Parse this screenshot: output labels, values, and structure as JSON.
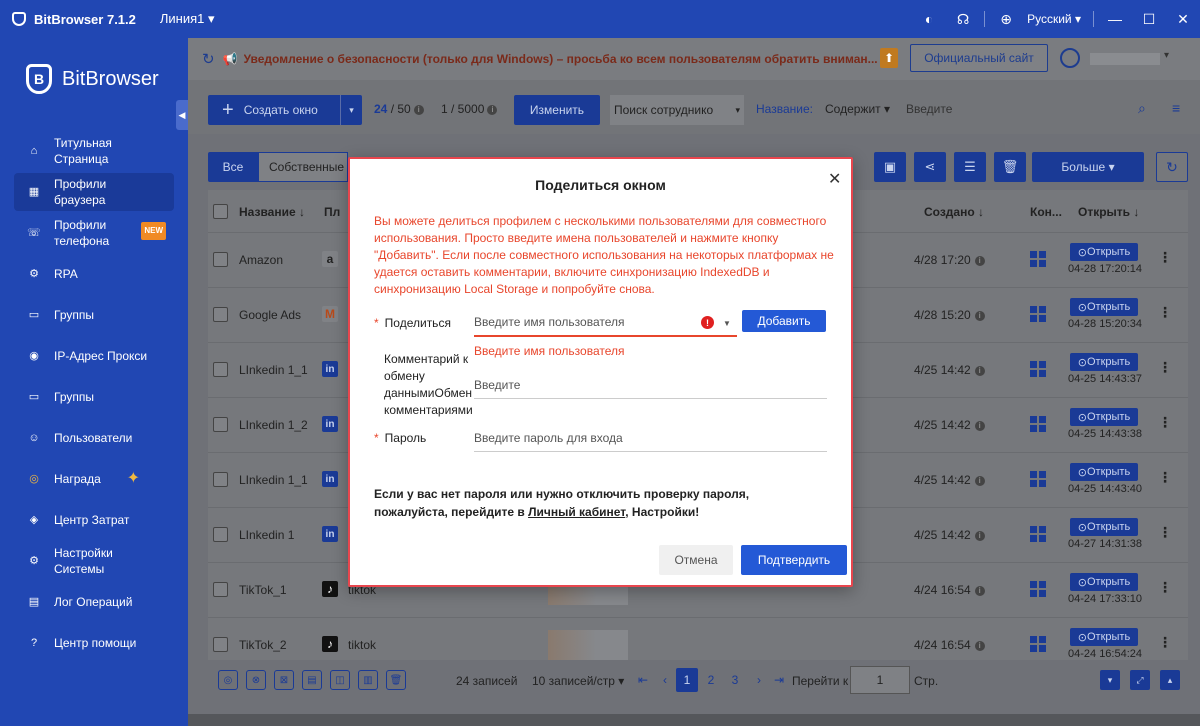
{
  "titlebar": {
    "app_name": "BitBrowser 7.1.2",
    "line": "Линия1 ▾",
    "language": "Русский ▾"
  },
  "sidebar": {
    "brand": "BitBrowser",
    "items": [
      {
        "label": "Титульная Страница",
        "icon": "home-icon"
      },
      {
        "label": "Профили браузера",
        "icon": "grid-icon",
        "active": true
      },
      {
        "label": "Профили телефона",
        "icon": "phone-icon",
        "badge": "NEW"
      },
      {
        "label": "RPA",
        "icon": "rpa-icon"
      },
      {
        "label": "Группы",
        "icon": "folder-icon"
      },
      {
        "label": "IP-Адрес Прокси",
        "icon": "location-icon"
      },
      {
        "label": "Группы",
        "icon": "folder-icon"
      },
      {
        "label": "Пользователи",
        "icon": "users-icon"
      },
      {
        "label": "Награда",
        "icon": "gift-icon"
      },
      {
        "label": "Центр Затрат",
        "icon": "shield-icon"
      },
      {
        "label": "Настройки Системы",
        "icon": "settings-icon"
      },
      {
        "label": "Лог Операций",
        "icon": "log-icon"
      },
      {
        "label": "Центр помощи",
        "icon": "help-icon"
      }
    ]
  },
  "notice": {
    "text": "Уведомление о безопасности (только для Windows) – просьба ко всем пользователям обратить вниман...",
    "site_button": "Официальный сайт"
  },
  "toolbar": {
    "create_label": "Создать окно",
    "count1_a": "24",
    "count1_b": "/ 50",
    "count2": "1 / 5000",
    "change_label": "Изменить",
    "employee_search": "Поиск сотруднико",
    "name_filter": "Название:",
    "contains": "Содержит ▾",
    "enter_placeholder": "Введите"
  },
  "tabs": {
    "all": "Все",
    "own": "Собственные",
    "more": "Больше ▾"
  },
  "table": {
    "headers": {
      "name": "Название ↓",
      "platform": "Пл",
      "created": "Создано ↓",
      "con": "Кон...",
      "open": "Открыть ↓"
    },
    "rows": [
      {
        "name": "Amazon",
        "platform_letter": "a",
        "platform_name": "",
        "date": "4/28 17:20",
        "open_time": "04-28 17:20:14"
      },
      {
        "name": "Google Ads",
        "platform_letter": "M",
        "platform_name": "",
        "date": "4/28 15:20",
        "open_time": "04-28 15:20:34"
      },
      {
        "name": "LInkedin 1_1",
        "platform_letter": "in",
        "platform_name": "",
        "date": "4/25 14:42",
        "open_time": "04-25 14:43:37"
      },
      {
        "name": "LInkedin 1_2",
        "platform_letter": "in",
        "platform_name": "",
        "date": "4/25 14:42",
        "open_time": "04-25 14:43:38"
      },
      {
        "name": "LInkedin 1_1",
        "platform_letter": "in",
        "platform_name": "",
        "date": "4/25 14:42",
        "open_time": "04-25 14:43:40"
      },
      {
        "name": "LInkedin 1",
        "platform_letter": "in",
        "platform_name": "",
        "date": "4/25 14:42",
        "open_time": "04-27 14:31:38"
      },
      {
        "name": "TikTok_1",
        "platform_letter": "♪",
        "platform_name": "tiktok",
        "date": "4/24 16:54",
        "open_time": "04-24 17:33:10"
      },
      {
        "name": "TikTok_2",
        "platform_letter": "♪",
        "platform_name": "tiktok",
        "date": "4/24 16:54",
        "open_time": "04-24 16:54:24"
      }
    ],
    "open_label": "Открыть"
  },
  "footer": {
    "records": "24 записей",
    "per_page": "10 записей/стр ▾",
    "pages": [
      "1",
      "2",
      "3"
    ],
    "goto_label": "Перейти к",
    "goto_value": "1",
    "page_suffix": "Стр."
  },
  "modal": {
    "title": "Поделиться окном",
    "description": "Вы можете делиться профилем с несколькими пользователями для совместного использования. Просто введите имена пользователей и нажмите кнопку \"Добавить\". Если после совместного использования на некоторых платформах не удается оставить комментарии, включите синхронизацию IndexedDB и синхронизацию Local Storage и попробуйте снова.",
    "share_label": "Поделиться",
    "share_placeholder": "Введите имя пользователя",
    "add_label": "Добавить",
    "error_message": "Введите имя пользователя",
    "comment_label": "Комментарий к обмену даннымиОбмен комментариями",
    "comment_placeholder": "Введите",
    "password_label": "Пароль",
    "password_placeholder": "Введите пароль для входа",
    "note_before": "Если у вас нет пароля или нужно отключить проверку пароля, пожалуйста, перейдите в ",
    "note_link": "Личный кабинет",
    "note_after": ", Настройки!",
    "cancel_label": "Отмена",
    "confirm_label": "Подтвердить"
  },
  "colors": {
    "primary": "#2147b3",
    "accent_button": "#2459d6",
    "error": "#e8462c",
    "modal_border": "#e8464e"
  }
}
